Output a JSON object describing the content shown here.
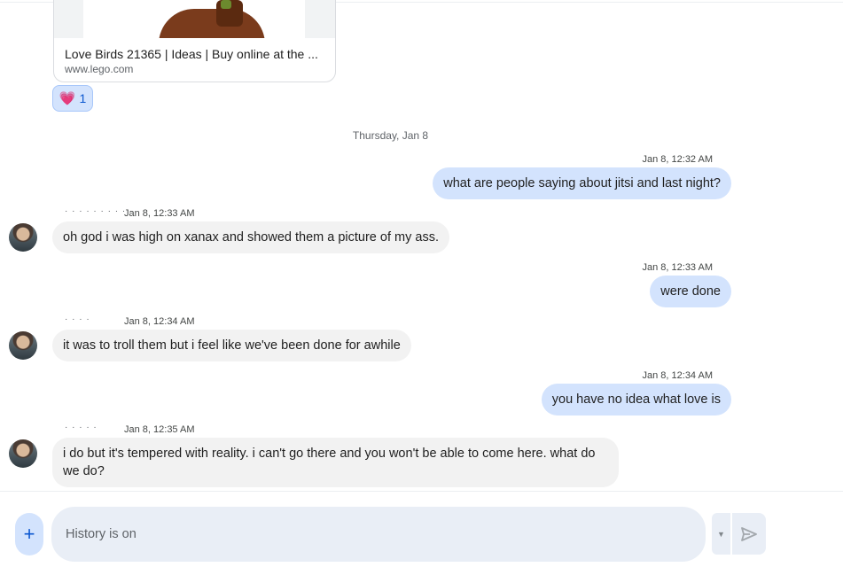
{
  "link_preview": {
    "title": "Love Birds 21365 | Ideas | Buy online at the ...",
    "url": "www.lego.com"
  },
  "reaction": {
    "emoji": "heart-icon",
    "count": "1"
  },
  "date_separator": "Thursday, Jan 8",
  "messages": [
    {
      "direction": "outgoing",
      "timestamp": "Jan 8, 12:32 AM",
      "text": "what are people saying about jitsi and last night?"
    },
    {
      "direction": "incoming",
      "timestamp": "Jan 8, 12:33 AM",
      "text": "oh god i was high on xanax and showed them a picture of my ass."
    },
    {
      "direction": "outgoing",
      "timestamp": "Jan 8, 12:33 AM",
      "text": "were done"
    },
    {
      "direction": "incoming",
      "timestamp": "Jan 8, 12:34 AM",
      "text": "it was to troll them but i feel like we've been done for awhile"
    },
    {
      "direction": "outgoing",
      "timestamp": "Jan 8, 12:34 AM",
      "text": "you have no idea what love is"
    },
    {
      "direction": "incoming",
      "timestamp": "Jan 8, 12:35 AM",
      "text": "i do but it's tempered with reality. i can't go there and you won't be able to come here. what do we do?"
    }
  ],
  "composer": {
    "add_label": "+",
    "placeholder": "History is on",
    "dropdown_icon": "chevron-down-icon",
    "send_icon": "send-icon"
  },
  "colors": {
    "outgoing_bubble": "#d3e3fd",
    "incoming_bubble": "#f2f2f2",
    "composer_bg": "#e9eef6",
    "accent": "#0b57d0"
  }
}
